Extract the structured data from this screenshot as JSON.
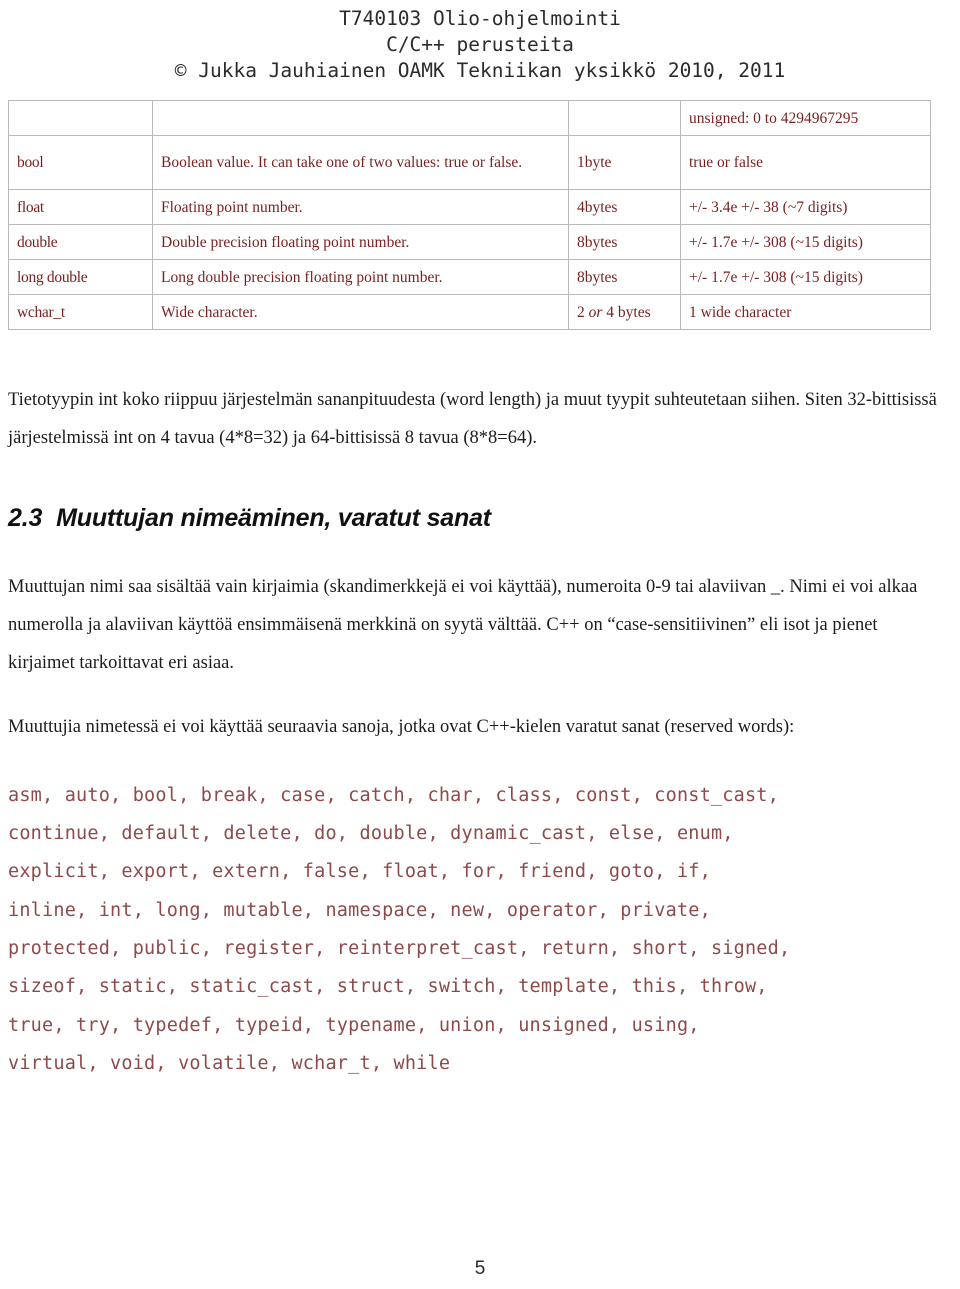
{
  "header": {
    "line1": "T740103 Olio-ohjelmointi",
    "line2": "C/C++ perusteita",
    "line3": "© Jukka Jauhiainen OAMK Tekniikan yksikkö 2010, 2011"
  },
  "table": {
    "continued_row": {
      "type": "",
      "description": "",
      "size": "",
      "range": "unsigned: 0 to 4294967295"
    },
    "rows": [
      {
        "type": "bool",
        "description": "Boolean value. It can take one of two values: true or false.",
        "size": "1byte",
        "range_true": "true",
        "range_sep": "or",
        "range_false": "false"
      },
      {
        "type": "float",
        "description": "Floating point number.",
        "size": "4bytes",
        "range": "+/- 3.4e +/- 38 (~7 digits)"
      },
      {
        "type": "double",
        "description": "Double precision floating point number.",
        "size": "8bytes",
        "range": "+/- 1.7e +/- 308 (~15 digits)"
      },
      {
        "type": "long double",
        "description": "Long double precision floating point number.",
        "size": "8bytes",
        "range": "+/- 1.7e +/- 308 (~15 digits)"
      },
      {
        "type": "wchar_t",
        "description": "Wide character.",
        "size_pre": "2 ",
        "size_or": "or",
        "size_post": " 4 bytes",
        "range": "1 wide character"
      }
    ]
  },
  "body": {
    "intro_paragraph": "Tietotyypin int koko riippuu järjestelmän sananpituudesta (word length) ja muut tyypit suhteutetaan siihen. Siten 32-bittisissä järjestelmissä int on 4 tavua  (4*8=32) ja 64-bittisissä 8 tavua (8*8=64).",
    "section_number": "2.3",
    "section_title": "Muuttujan nimeäminen, varatut sanat",
    "naming_paragraph": "Muuttujan nimi saa sisältää vain kirjaimia (skandimerkkejä ei voi käyttää), numeroita 0-9 tai alaviivan _. Nimi ei voi alkaa numerolla ja alaviivan käyttöä ensimmäisenä merkkinä on syytä välttää. C++ on “case-sensitiivinen” eli isot ja pienet kirjaimet tarkoittavat eri asiaa.",
    "reserved_paragraph": "Muuttujia nimetessä ei voi käyttää seuraavia sanoja, jotka ovat C++-kielen varatut sanat (reserved words):"
  },
  "keywords": {
    "lines": [
      "asm, auto, bool, break, case, catch, char, class, const, const_cast,",
      "continue, default, delete, do, double, dynamic_cast, else, enum,",
      "explicit, export, extern, false, float, for, friend, goto, if,",
      "inline, int, long, mutable, namespace, new, operator, private,",
      "protected, public, register, reinterpret_cast, return, short, signed,",
      "sizeof, static, static_cast, struct, switch, template, this, throw,",
      "true, try, typedef, typeid, typename, union, unsigned, using,",
      "virtual, void, volatile, wchar_t, while"
    ]
  },
  "footer": {
    "page_number": "5"
  },
  "colors": {
    "table_text": "#7a1f1f",
    "code_text": "#8a2d2d",
    "keyword_text": "#8e4a4a",
    "border": "#b9b9b9",
    "body_text": "#1c1c1c"
  }
}
